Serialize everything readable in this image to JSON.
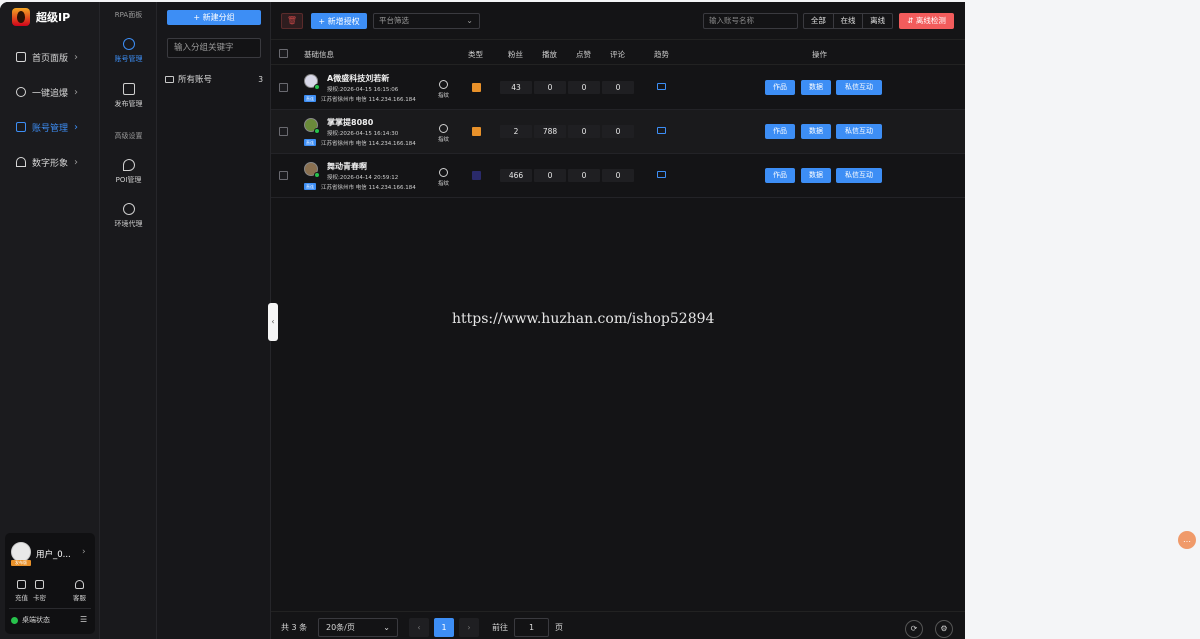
{
  "app": {
    "name": "超级IP"
  },
  "sidebar": {
    "items": [
      {
        "label": "首页面版",
        "active": false,
        "icon": "home-icon"
      },
      {
        "label": "一键追爆",
        "active": false,
        "icon": "globe-icon"
      },
      {
        "label": "账号管理",
        "active": true,
        "icon": "phone-icon"
      },
      {
        "label": "数字形象",
        "active": false,
        "icon": "umbrella-icon"
      }
    ],
    "chevron": "›"
  },
  "subnav": {
    "section1": "RPA面板",
    "items1": [
      {
        "label": "账号管理",
        "active": true,
        "icon": "user-icon"
      },
      {
        "label": "发布管理",
        "active": false,
        "icon": "publish-icon"
      }
    ],
    "section2": "高级设置",
    "items2": [
      {
        "label": "POI管理",
        "icon": "location-icon"
      },
      {
        "label": "环境代理",
        "icon": "globe-icon"
      }
    ]
  },
  "groups": {
    "new_button": "+ 新建分组",
    "search_placeholder": "输入分组关键字",
    "all": {
      "label": "所有账号",
      "count": "3"
    }
  },
  "user": {
    "name": "用户_0...",
    "badge": "发布版",
    "actions": [
      {
        "label": "充值",
        "icon": "grid-icon"
      },
      {
        "label": "卡密",
        "icon": "gift-icon"
      },
      {
        "label": "客服",
        "icon": "headset-icon"
      }
    ],
    "status": "桌端状态",
    "status_color": "#27c24c"
  },
  "toolbar": {
    "delete_icon": "🗑",
    "auth_button": "+ 新增授权",
    "platform_filter": "平台筛选",
    "account_search_placeholder": "输入账号名称",
    "segments": [
      "全部",
      "在线",
      "离线"
    ],
    "offline_check": "⇵ 离线检测"
  },
  "table": {
    "headers": {
      "basic": "基础信息",
      "type": "类型",
      "fans": "粉丝",
      "plays": "播放",
      "likes": "点赞",
      "comments": "评论",
      "trend": "趋势",
      "ops": "操作"
    },
    "rows": [
      {
        "name": "A微盛科技刘若新",
        "authorized": "授权:2026-04-15 16:15:06",
        "tag": "直连",
        "location": "江苏省徐州市 电信 114.234.166.184",
        "fingerprint": "指纹",
        "fans": "43",
        "plays": "0",
        "likes": "0",
        "comments": "0"
      },
      {
        "name": "掌掌提8080",
        "authorized": "授权:2026-04-15 16:14:30",
        "tag": "直连",
        "location": "江苏省徐州市 电信 114.234.166.184",
        "fingerprint": "指纹",
        "fans": "2",
        "plays": "788",
        "likes": "0",
        "comments": "0"
      },
      {
        "name": "舞动青春啊",
        "authorized": "授权:2026-04-14 20:59:12",
        "tag": "直连",
        "location": "江苏省徐州市 电信 114.234.166.184",
        "fingerprint": "指纹",
        "fans": "466",
        "plays": "0",
        "likes": "0",
        "comments": "0"
      }
    ],
    "actions": [
      "作品",
      "数据",
      "私信互动"
    ]
  },
  "watermark": "https://www.huzhan.com/ishop52894",
  "pagination": {
    "total": "共 3 条",
    "page_size": "20条/页",
    "prev": "‹",
    "current": "1",
    "next": "›",
    "goto_label": "前往",
    "goto_value": "1",
    "page_label": "页"
  },
  "accent_color": "#3d8ef5"
}
